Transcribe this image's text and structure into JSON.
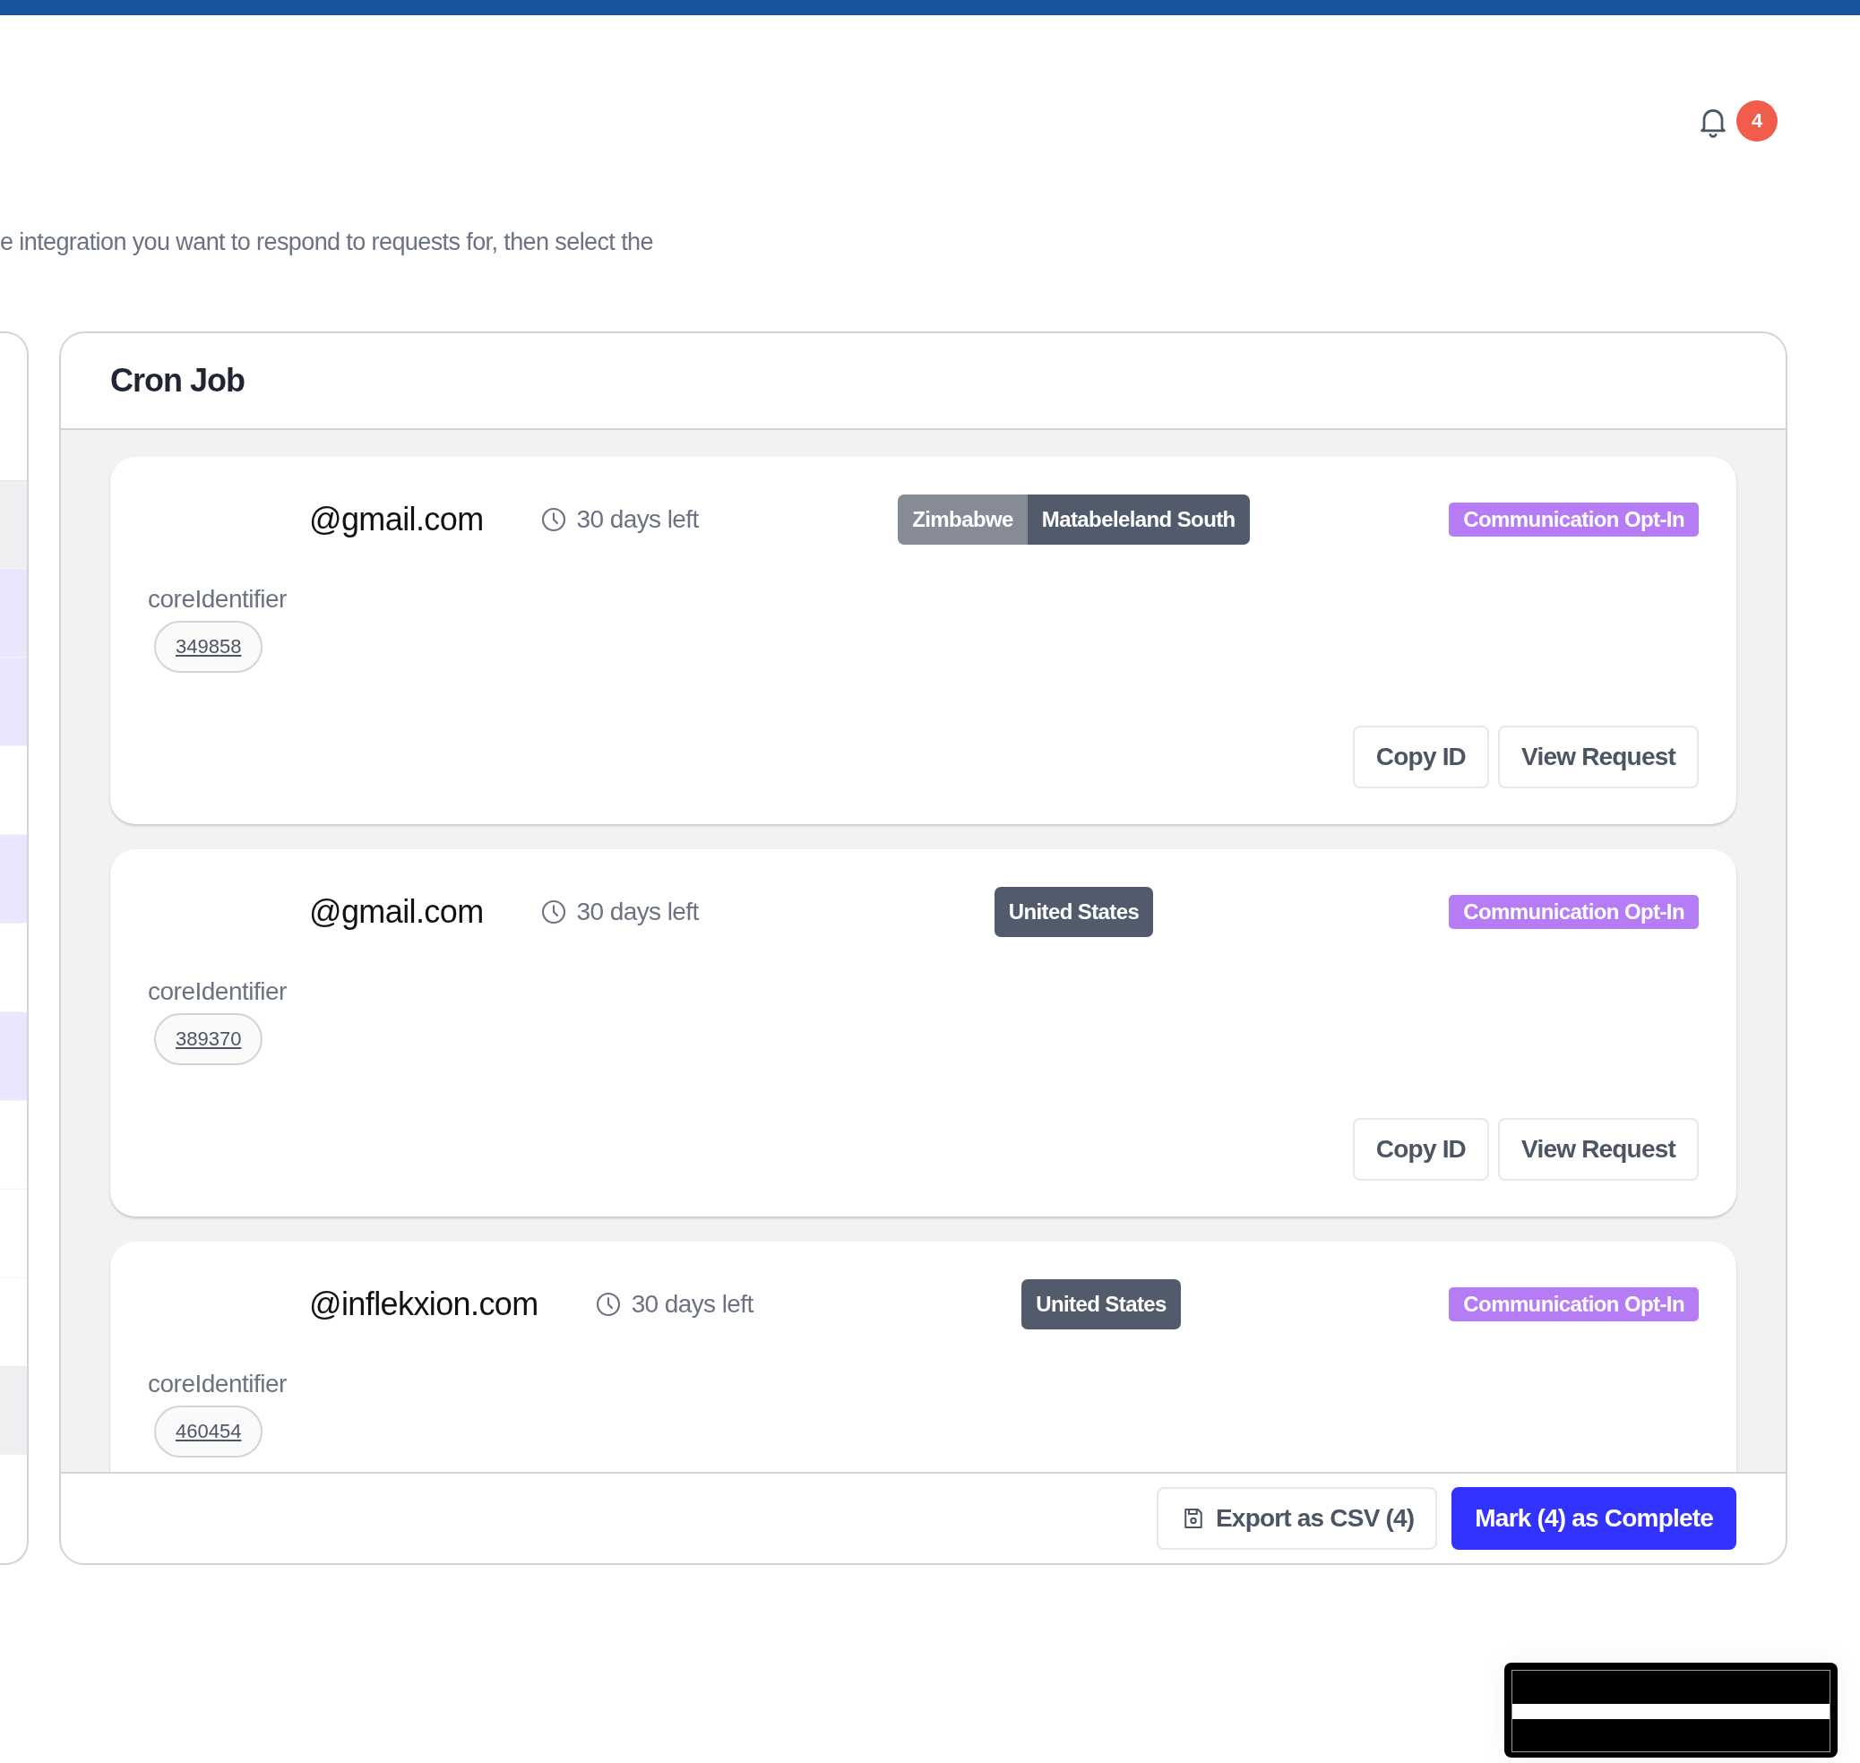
{
  "notifications": {
    "count": "4"
  },
  "description": "e integration you want to respond to requests for, then select the",
  "side_panel": {
    "rows": [
      {
        "kind": "group"
      },
      {
        "kind": "row",
        "selected": true
      },
      {
        "kind": "row",
        "selected": true
      },
      {
        "kind": "row",
        "selected": false
      },
      {
        "kind": "row",
        "selected": true
      },
      {
        "kind": "row",
        "selected": false
      },
      {
        "kind": "row",
        "selected": true
      },
      {
        "kind": "row",
        "selected": false
      },
      {
        "kind": "row",
        "selected": false
      },
      {
        "kind": "row",
        "selected": false
      },
      {
        "kind": "group"
      },
      {
        "kind": "row",
        "selected": false
      }
    ]
  },
  "panel": {
    "title": "Cron Job",
    "requests": [
      {
        "email": "@gmail.com",
        "time_left": "30 days left",
        "location": [
          "Zimbabwe",
          "Matabeleland South"
        ],
        "type": "Communication Opt-In",
        "id_label": "coreIdentifier",
        "id": "349858",
        "actions": [
          "Copy ID",
          "View Request"
        ]
      },
      {
        "email": "@gmail.com",
        "time_left": "30 days left",
        "location": [
          "United States"
        ],
        "type": "Communication Opt-In",
        "id_label": "coreIdentifier",
        "id": "389370",
        "actions": [
          "Copy ID",
          "View Request"
        ]
      },
      {
        "email": "@inflekxion.com",
        "time_left": "30 days left",
        "location": [
          "United States"
        ],
        "type": "Communication Opt-In",
        "id_label": "coreIdentifier",
        "id": "460454"
      }
    ],
    "footer_buttons": [
      {
        "kind": "secondary",
        "label": "Export as CSV (4)"
      },
      {
        "kind": "primary",
        "label": "Mark (4) as Complete"
      }
    ]
  }
}
